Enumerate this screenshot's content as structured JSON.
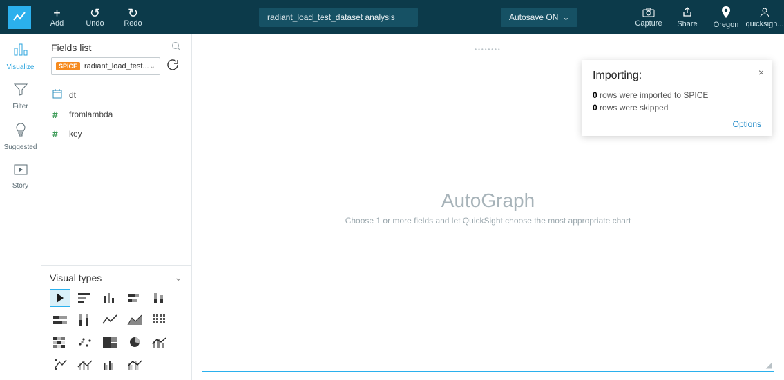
{
  "topbar": {
    "add": "Add",
    "undo": "Undo",
    "redo": "Redo",
    "title": "radiant_load_test_dataset analysis",
    "autosave": "Autosave ON",
    "capture": "Capture",
    "share": "Share",
    "region": "Oregon",
    "user": "quicksigh..."
  },
  "rail": {
    "visualize": "Visualize",
    "filter": "Filter",
    "suggested": "Suggested",
    "story": "Story"
  },
  "fields": {
    "heading": "Fields list",
    "dataset_badge": "SPICE",
    "dataset_name": "radiant_load_test...",
    "items": [
      {
        "type": "date",
        "label": "dt"
      },
      {
        "type": "num",
        "label": "fromlambda"
      },
      {
        "type": "num",
        "label": "key"
      }
    ]
  },
  "visualtypes": {
    "heading": "Visual types"
  },
  "canvas": {
    "title": "AutoGraph",
    "subtitle": "Choose 1 or more fields and let QuickSight choose the most appropriate chart"
  },
  "toast": {
    "title": "Importing:",
    "rows_imported_count": "0",
    "rows_imported_text": " rows were imported to SPICE",
    "rows_skipped_count": "0",
    "rows_skipped_text": " rows were skipped",
    "options": "Options"
  }
}
